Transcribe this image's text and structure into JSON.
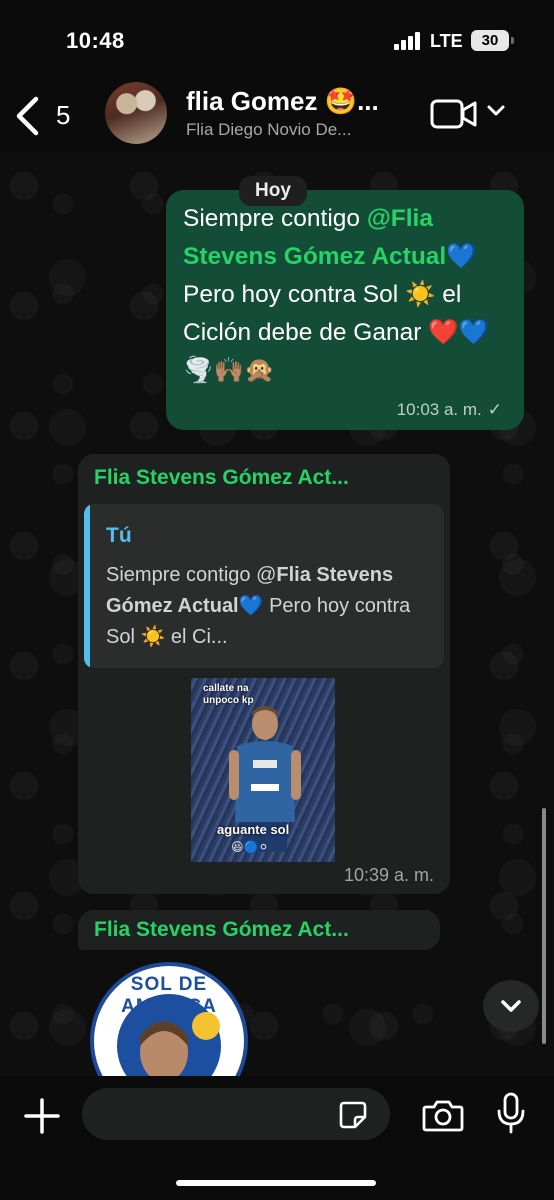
{
  "status_bar": {
    "time": "10:48",
    "network": "LTE",
    "battery": "30"
  },
  "header": {
    "back_count": "5",
    "title": "flia Gomez 🤩...",
    "subtitle": "Flia Diego Novio De..."
  },
  "chat": {
    "date_chip": "Hoy",
    "outgoing": {
      "text_before": "Siempre contigo ",
      "mention": "@Flia Stevens Gómez Actual",
      "text_after": "💙 Pero hoy contra Sol ☀️ el Ciclón debe de Ganar ❤️💙🌪️🙌🏽🙊",
      "time": "10:03 a. m.",
      "tick": "✓"
    },
    "reply": {
      "sender": "Flia Stevens Gómez Act...",
      "quote_author": "Tú",
      "quote_text_before": "Siempre contigo @",
      "quote_mention": "Flia Stevens Gómez Actual",
      "quote_text_after": "💙 Pero hoy contra Sol ☀️ el Ci...",
      "sticker_top_text": "callate na\nunpoco kp",
      "sticker_bottom_text": "aguante sol",
      "sticker_emoji": "😃🔵⚪",
      "time": "10:39 a. m."
    },
    "next_message": {
      "sender": "Flia Stevens Gómez Act...",
      "badge_text": "SOL DE AMERICA"
    }
  },
  "composer": {
    "placeholder": ""
  },
  "colors": {
    "accent_green": "#25d366",
    "outgoing_bubble": "#134d37",
    "incoming_bubble": "#1f2120",
    "quote_blue": "#53bdeb"
  },
  "icons": [
    "back-chevron-icon",
    "video-call-icon",
    "chevron-down-icon",
    "plus-icon",
    "sticker-icon",
    "camera-icon",
    "microphone-icon",
    "scroll-down-icon"
  ]
}
